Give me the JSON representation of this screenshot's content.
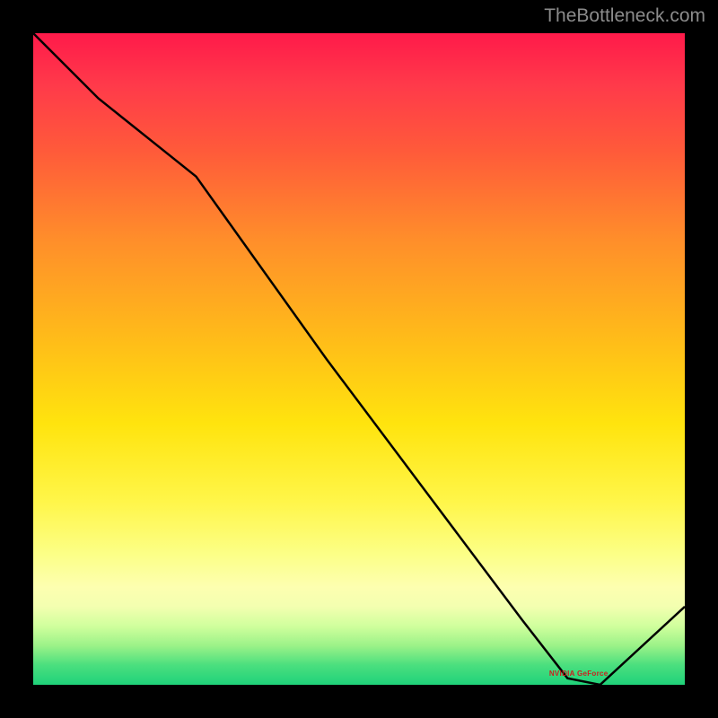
{
  "watermark": "TheBottleneck.com",
  "chart_data": {
    "type": "line",
    "title": "",
    "xlabel": "",
    "ylabel": "",
    "x": [
      0.0,
      0.1,
      0.25,
      0.45,
      0.6,
      0.75,
      0.82,
      0.87,
      1.0
    ],
    "y": [
      1.0,
      0.9,
      0.78,
      0.5,
      0.3,
      0.1,
      0.01,
      0.0,
      0.12
    ],
    "xlim": [
      0,
      1
    ],
    "ylim": [
      0,
      1
    ],
    "annotations": [
      {
        "label": "NVIDIA GeForce",
        "x": 0.84,
        "y": 0.015
      }
    ],
    "background_scale": [
      "#ff1a4a",
      "#ffbf18",
      "#fff64a",
      "#1fd27a"
    ]
  }
}
